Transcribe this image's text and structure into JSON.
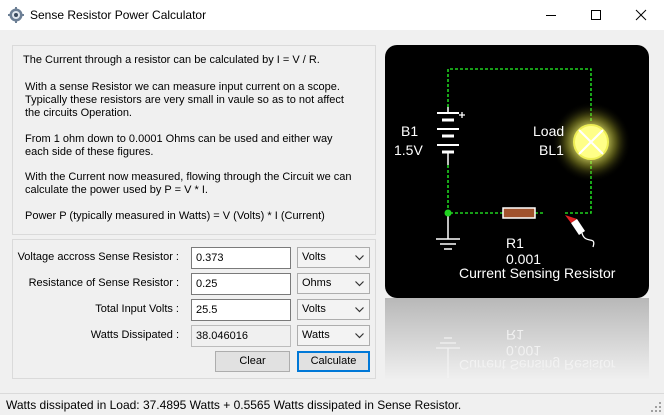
{
  "window": {
    "title": "Sense Resistor Power Calculator",
    "controls": [
      "minimize",
      "maximize",
      "close"
    ]
  },
  "info": {
    "lines": [
      "The Current through a resistor can be calculated by I = V / R.",
      "With a sense Resistor we can measure input current on a scope.",
      "Typically these resistors are very small in vaule so as to not affect",
      "the circuits Operation.",
      "From 1 ohm down to 0.0001 Ohms can be used and either way",
      "each side of these figures.",
      "With the Current now measured, flowing through the Circuit we can",
      "calculate the power used by P = V * I.",
      "Power P (typically measured in Watts) = V (Volts) * I (Current)"
    ]
  },
  "form": {
    "voltage_sense": {
      "label": "Voltage accross Sense Resistor :",
      "value": "0.373",
      "unit": "Volts"
    },
    "resistance": {
      "label": "Resistance of Sense Resistor :",
      "value": "0.25",
      "unit": "Ohms"
    },
    "input_volts": {
      "label": "Total Input Volts :",
      "value": "25.5",
      "unit": "Volts"
    },
    "watts": {
      "label": "Watts Dissipated :",
      "value": "38.046016",
      "unit": "Watts"
    },
    "clear_label": "Clear",
    "calculate_label": "Calculate"
  },
  "circuit": {
    "battery_name": "B1",
    "battery_voltage": "1.5V",
    "load_label": "Load",
    "load_name": "BL1",
    "resistor_name": "R1",
    "resistor_value": "0.001",
    "resistor_caption": "Current Sensing Resistor",
    "wire_color": "#1fd11f",
    "glow_color": "#ffff66"
  },
  "status": {
    "text": "Watts dissipated in Load: 37.4895 Watts + 0.5565 Watts dissipated in Sense Resistor."
  }
}
